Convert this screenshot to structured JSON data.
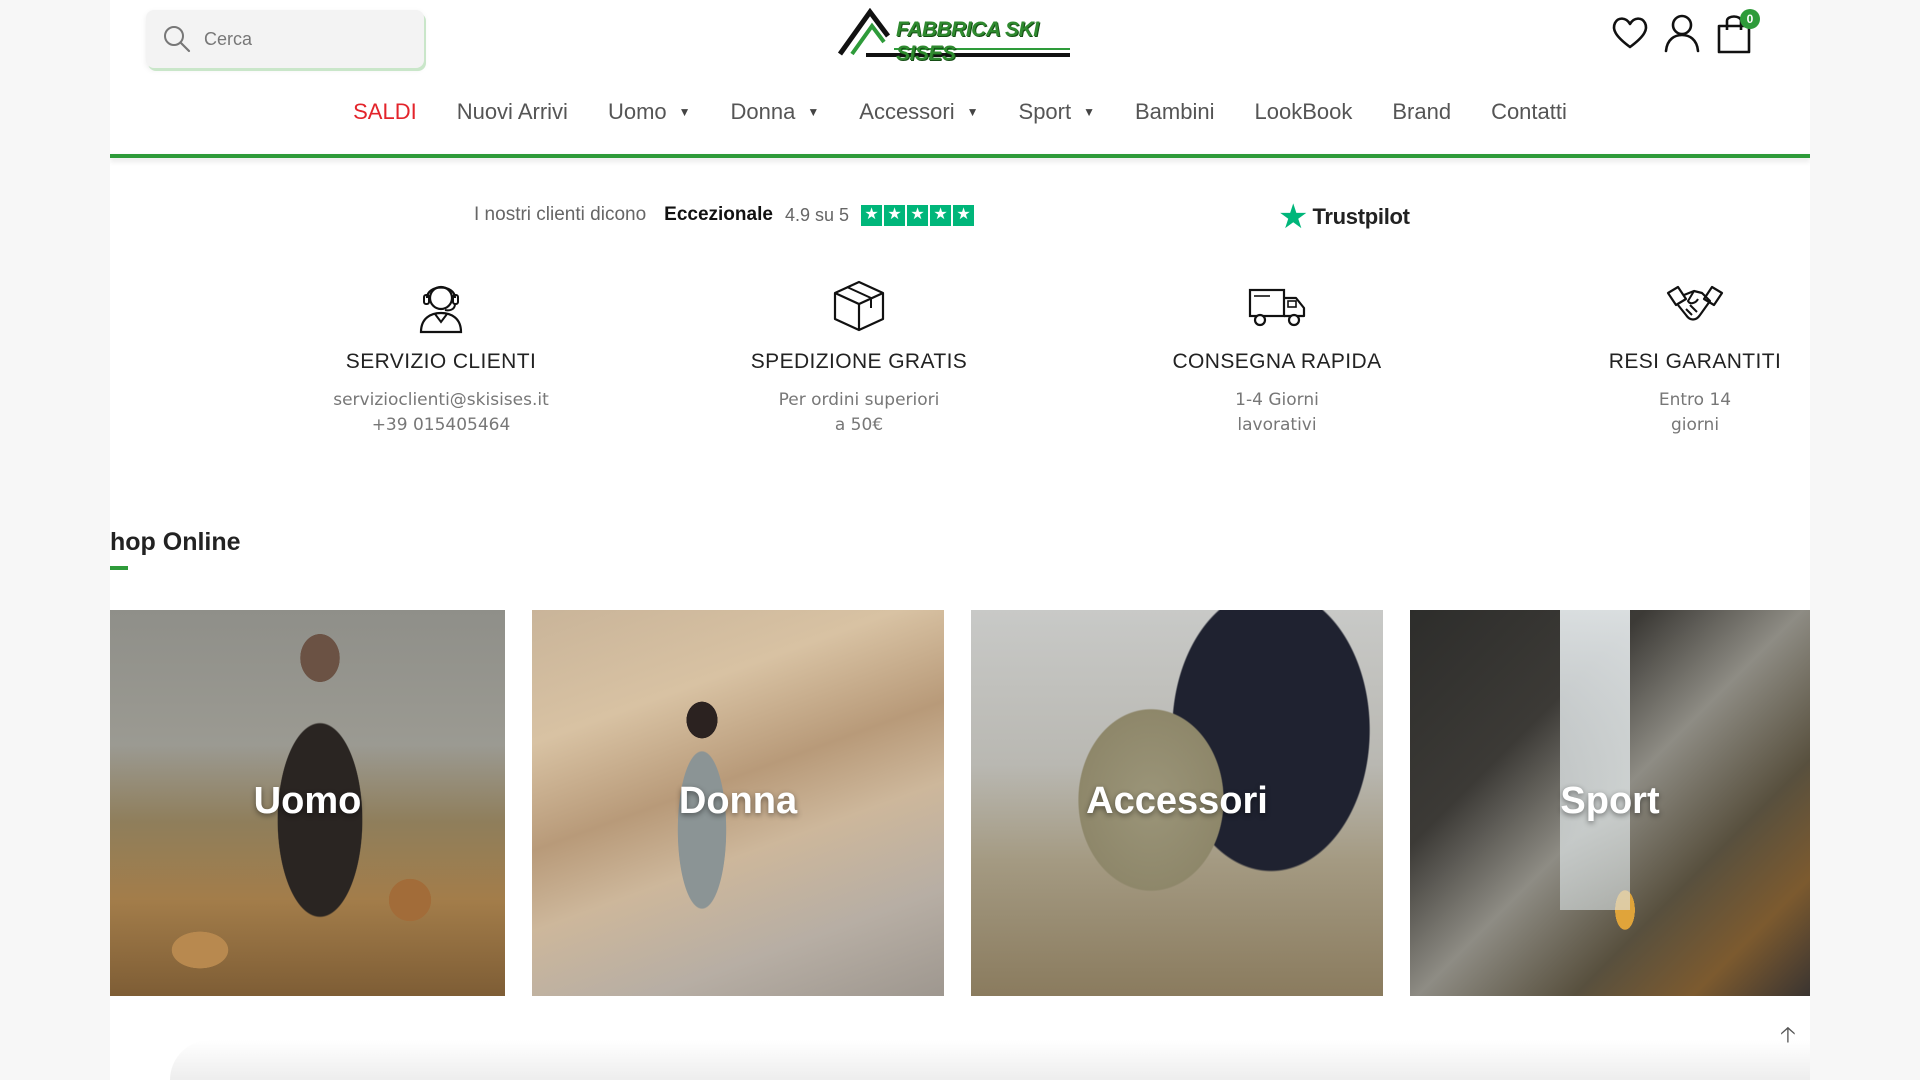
{
  "header": {
    "search_placeholder": "Cerca",
    "logo_text": "FABBRICA SKI SISES",
    "cart_count": "0"
  },
  "nav": [
    {
      "label": "SALDI",
      "has_dropdown": false
    },
    {
      "label": "Nuovi Arrivi",
      "has_dropdown": false
    },
    {
      "label": "Uomo",
      "has_dropdown": true
    },
    {
      "label": "Donna",
      "has_dropdown": true
    },
    {
      "label": "Accessori",
      "has_dropdown": true
    },
    {
      "label": "Sport",
      "has_dropdown": true
    },
    {
      "label": "Bambini",
      "has_dropdown": false
    },
    {
      "label": "LookBook",
      "has_dropdown": false
    },
    {
      "label": "Brand",
      "has_dropdown": false
    },
    {
      "label": "Contatti",
      "has_dropdown": false
    }
  ],
  "trust": {
    "says": "I nostri clienti dicono",
    "rating": "Eccezionale",
    "score": "4.9 su 5",
    "stars": 5,
    "brand": "Trustpilot"
  },
  "features": [
    {
      "icon": "customer-service-icon",
      "title": "SERVIZIO CLIENTI",
      "line1": "servizioclienti@skisises.it",
      "line2": "+39 015405464"
    },
    {
      "icon": "box-icon",
      "title": "SPEDIZIONE GRATIS",
      "line1": "Per ordini superiori",
      "line2": "a 50€"
    },
    {
      "icon": "truck-icon",
      "title": "CONSEGNA RAPIDA",
      "line1": "1-4 Giorni",
      "line2": "lavorativi"
    },
    {
      "icon": "handshake-icon",
      "title": "RESI GARANTITI",
      "line1": "Entro 14",
      "line2": "giorni"
    }
  ],
  "shop": {
    "title": "hop Online",
    "categories": [
      {
        "label": "Uomo"
      },
      {
        "label": "Donna"
      },
      {
        "label": "Accessori"
      },
      {
        "label": "Sport"
      }
    ]
  },
  "colors": {
    "accent_green": "#2e9b3a",
    "sale_red": "#e3242b",
    "trustpilot_green": "#00b67a"
  }
}
